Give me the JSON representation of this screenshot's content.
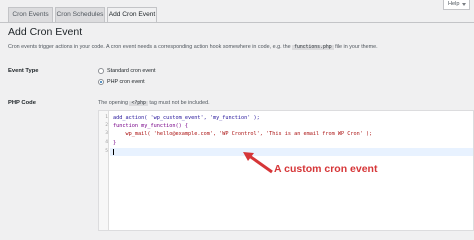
{
  "tabs": [
    {
      "label": "Cron Events"
    },
    {
      "label": "Cron Schedules"
    },
    {
      "label": "Add Cron Event"
    }
  ],
  "help": {
    "label": "Help"
  },
  "page": {
    "title": "Add Cron Event",
    "description_before": "Cron events trigger actions in your code. A cron event needs a corresponding action hook somewhere in code, e.g. the ",
    "description_code": "functions.php",
    "description_after": " file in your theme."
  },
  "event_type": {
    "label": "Event Type",
    "options": [
      {
        "label": "Standard cron event",
        "checked": false
      },
      {
        "label": "PHP cron event",
        "checked": true
      }
    ]
  },
  "php_code": {
    "label": "PHP Code",
    "hint_before": "The opening ",
    "hint_code": "<?php",
    "hint_after": " tag must not be included.",
    "lines": [
      {
        "n": "1",
        "text": "add_action( 'wp_custom_event', 'my_function' );"
      },
      {
        "n": "2",
        "text": "function my_function() {"
      },
      {
        "n": "3",
        "text": "    wp_mail( 'hello@example.com', 'WP Crontrol', 'This is an email from WP Cron' );"
      },
      {
        "n": "4",
        "text": "}"
      },
      {
        "n": "5",
        "text": ""
      }
    ]
  },
  "annotation": {
    "text": "A custom cron event",
    "color": "#d63638"
  }
}
